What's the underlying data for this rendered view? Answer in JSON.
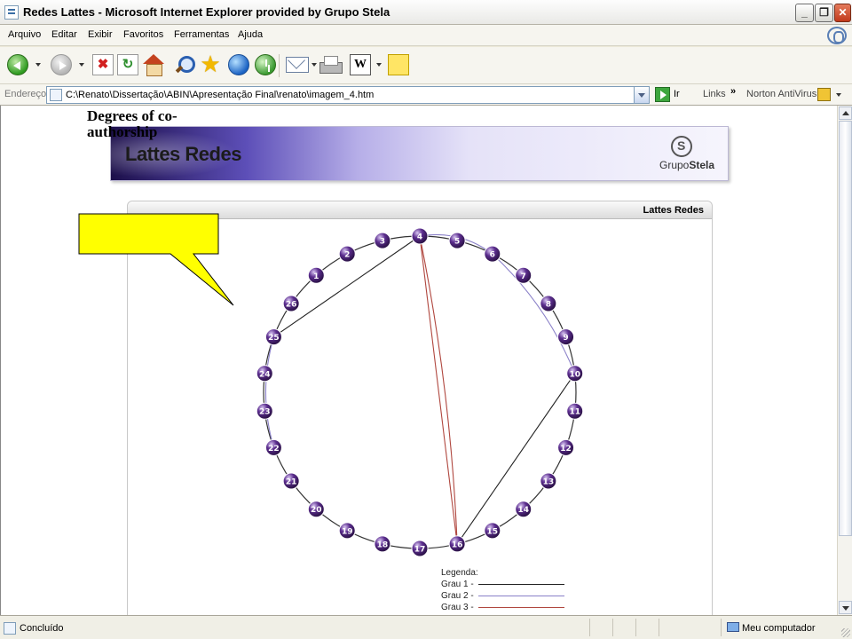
{
  "window": {
    "title": "Redes Lattes - Microsoft Internet Explorer provided by Grupo Stela",
    "controls": {
      "minimize": "_",
      "maximize": "❐",
      "close": "✕"
    }
  },
  "menu": [
    "Arquivo",
    "Editar",
    "Exibir",
    "Favoritos",
    "Ferramentas",
    "Ajuda"
  ],
  "toolbar": {
    "icons": [
      "back-icon",
      "forward-icon",
      "stop-icon",
      "refresh-icon",
      "home-icon",
      "search-icon",
      "favorites-icon",
      "media-icon",
      "history-icon",
      "mail-icon",
      "print-icon",
      "edit-word-icon",
      "notes-icon"
    ],
    "stop_glyph": "✖",
    "refresh_glyph": "↻",
    "fav_glyph": "★",
    "word_glyph": "W"
  },
  "address": {
    "label": "Endereço",
    "url": "C:\\Renato\\Dissertação\\ABIN\\Apresentação Final\\renato\\imagem_4.htm",
    "go_label": "Ir",
    "links_label": "Links",
    "chevron": "»",
    "norton_label": "Norton AntiVirus"
  },
  "banner": {
    "title": "Lattes Redes",
    "brand_prefix": "Grupo",
    "brand_bold": "Stela"
  },
  "panel": {
    "title": "Lattes Redes"
  },
  "graph": {
    "node_color": "#5b2d8e",
    "edge_colors": {
      "grau1": "#222222",
      "grau2": "#8a80c8",
      "grau3": "#b0473f"
    },
    "nodes": [
      "1",
      "2",
      "3",
      "4",
      "5",
      "6",
      "7",
      "8",
      "9",
      "10",
      "11",
      "12",
      "13",
      "14",
      "15",
      "16",
      "17",
      "18",
      "19",
      "20",
      "21",
      "22",
      "23",
      "24",
      "25",
      "26"
    ],
    "edges": [
      {
        "from": "4",
        "to": "25",
        "grau": 1
      },
      {
        "from": "10",
        "to": "16",
        "grau": 1
      },
      {
        "from": "4",
        "to": "6",
        "grau": 2
      },
      {
        "from": "6",
        "to": "10",
        "grau": 2
      },
      {
        "from": "25",
        "to": "22",
        "grau": 2
      },
      {
        "from": "4",
        "to": "16",
        "grau": 3
      }
    ]
  },
  "legend": {
    "title": "Legenda:",
    "items": [
      {
        "label": "Grau 1 -",
        "color": "#222222"
      },
      {
        "label": "Grau 2 -",
        "color": "#8a80c8"
      },
      {
        "label": "Grau 3 -",
        "color": "#b0473f"
      }
    ]
  },
  "callout": {
    "text": "Degrees of co-authorship",
    "fill": "#ffff00"
  },
  "status": {
    "text": "Concluído",
    "zone": "Meu computador"
  }
}
